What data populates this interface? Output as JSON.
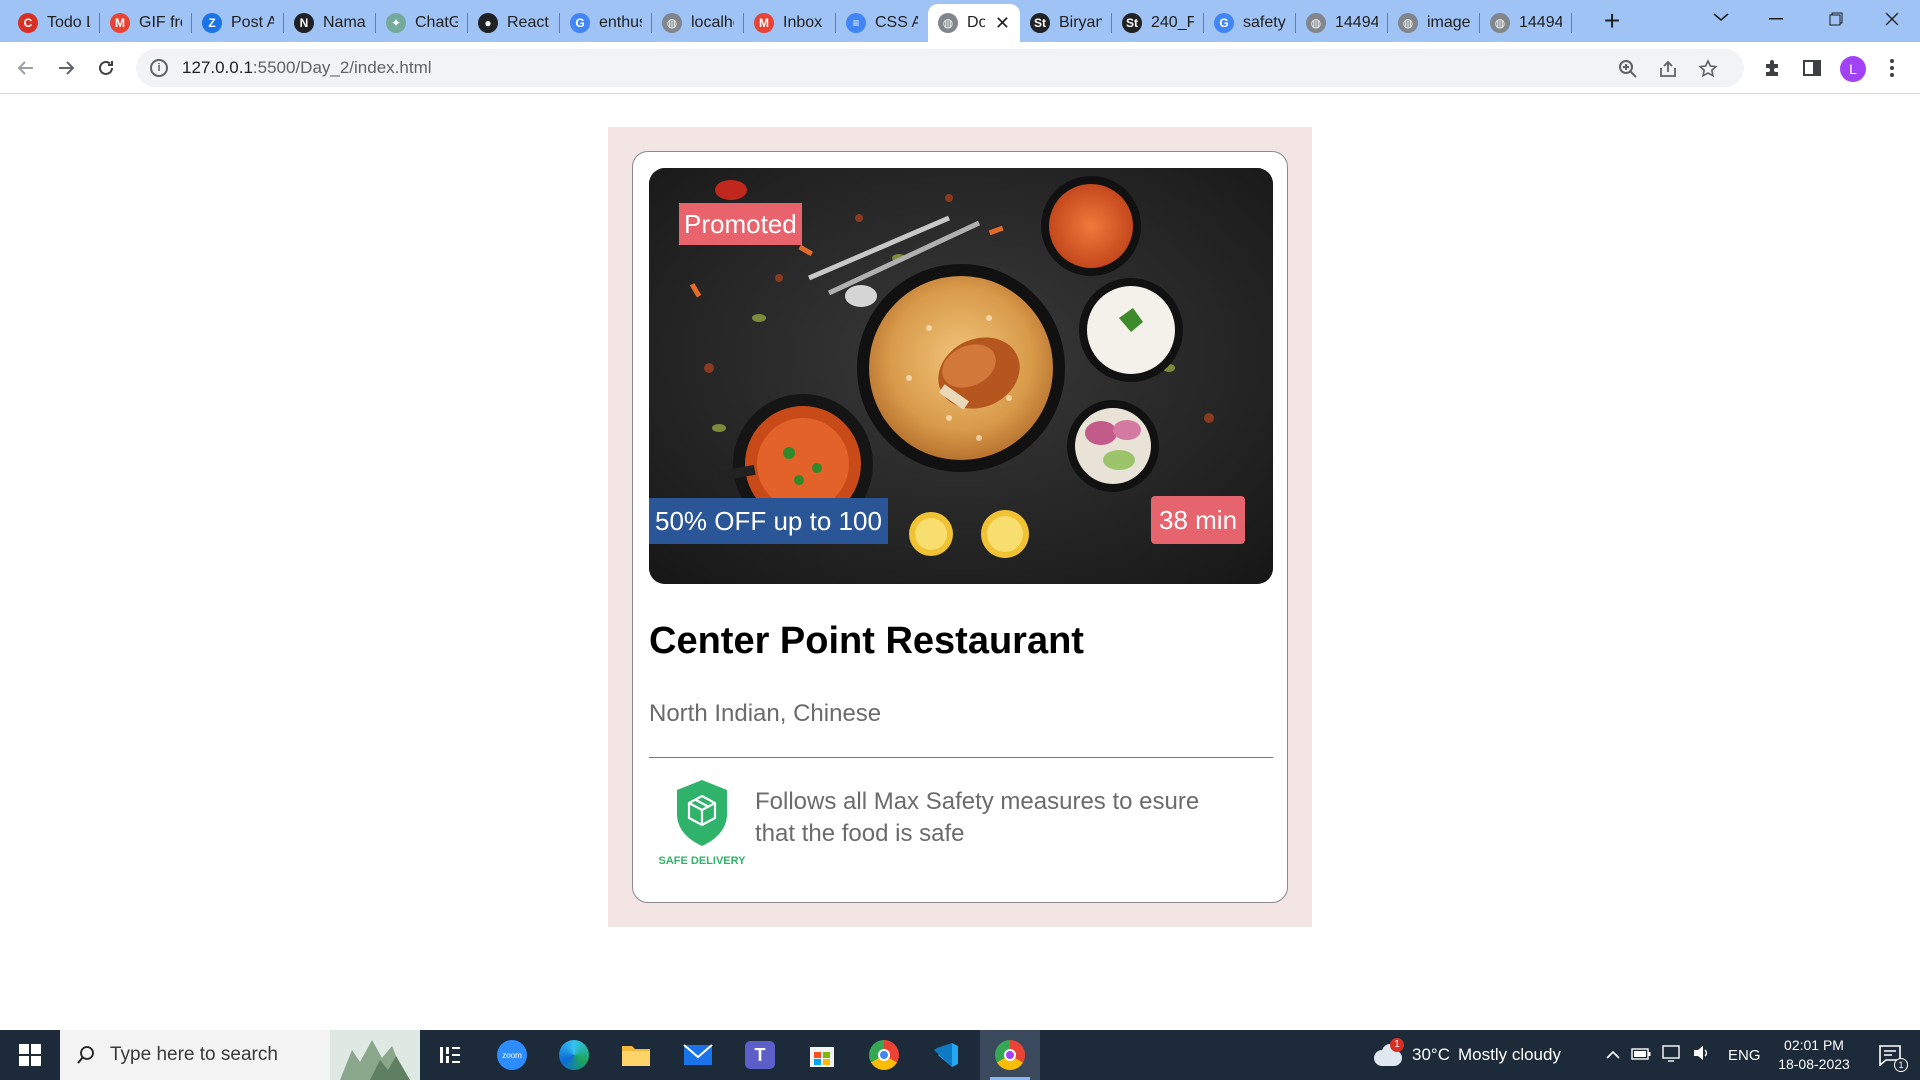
{
  "browser": {
    "tabs": [
      {
        "title": "Todo List",
        "icon": "todo-app-icon",
        "color": "#d93025"
      },
      {
        "title": "GIF from",
        "icon": "gmail-icon",
        "color": "#ea4335"
      },
      {
        "title": "Post A",
        "icon": "zoho-icon",
        "color": "#1a73e8"
      },
      {
        "title": "Namaste",
        "icon": "namaste-icon",
        "color": "#202124"
      },
      {
        "title": "ChatGPT",
        "icon": "chatgpt-icon",
        "color": "#74aa9c"
      },
      {
        "title": "React",
        "icon": "github-icon",
        "color": "#202124"
      },
      {
        "title": "enthusiast",
        "icon": "google-icon",
        "color": "#4285f4"
      },
      {
        "title": "localhost",
        "icon": "globe-icon",
        "color": "#80868b"
      },
      {
        "title": "Inbox",
        "icon": "gmail-icon",
        "color": "#ea4335"
      },
      {
        "title": "CSS Art",
        "icon": "docs-icon",
        "color": "#4285f4"
      },
      {
        "title": "Document",
        "icon": "globe-icon",
        "color": "#80868b",
        "active": true
      },
      {
        "title": "Biryani",
        "icon": "stackblitz-icon",
        "color": "#202124"
      },
      {
        "title": "240_F",
        "icon": "stackblitz-icon",
        "color": "#202124"
      },
      {
        "title": "safety",
        "icon": "google-icon",
        "color": "#4285f4"
      },
      {
        "title": "14494",
        "icon": "globe-icon",
        "color": "#80868b"
      },
      {
        "title": "image",
        "icon": "globe-icon",
        "color": "#80868b"
      },
      {
        "title": "14494",
        "icon": "globe-icon",
        "color": "#80868b"
      }
    ],
    "url_host": "127.0.0.1",
    "url_path": ":5500/Day_2/index.html",
    "profile_initial": "L"
  },
  "card": {
    "badge_promoted": "Promoted",
    "badge_offer": "50% OFF up to 100",
    "badge_time": "38 min",
    "name": "Center Point Restaurant",
    "cuisine": "North Indian, Chinese",
    "safety_text": "Follows all Max Safety measures to esure that the food is safe",
    "safety_logo_text": "SAFE DELIVERY",
    "colors": {
      "promoted": "#e8636b",
      "offer": "#2a5596",
      "time": "#e5646d",
      "wrap_bg": "#f3e5e3",
      "safe_green": "#2fb36a"
    }
  },
  "taskbar": {
    "search_placeholder": "Type here to search",
    "weather_temp": "30°C",
    "weather_text": "Mostly cloudy",
    "weather_badge": "1",
    "language": "ENG",
    "time": "02:01 PM",
    "date": "18-08-2023",
    "notification_count": "1"
  }
}
